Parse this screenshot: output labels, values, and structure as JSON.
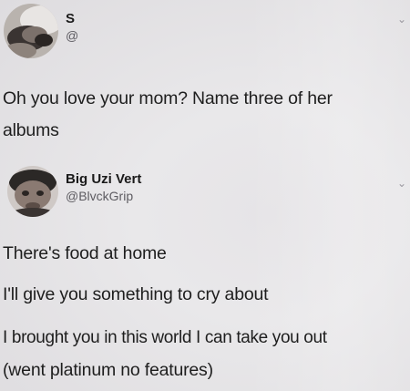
{
  "tweet1": {
    "display_name": "S",
    "handle": "@",
    "text_line1": "Oh you love your mom? Name three of her",
    "text_line2": "albums"
  },
  "tweet2": {
    "display_name": "Big Uzi Vert",
    "handle": "@BlvckGrip",
    "lines": [
      "There's food at home",
      "I'll give you something to cry about",
      "I brought you in this world I can take you out",
      "(went platinum no features)"
    ]
  },
  "icons": {
    "more": "chevron-down-icon"
  }
}
